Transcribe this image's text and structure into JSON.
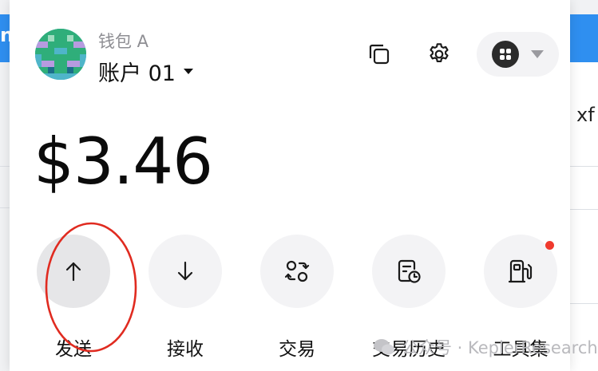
{
  "background": {
    "left_text": "na",
    "right_text": "xf"
  },
  "header": {
    "wallet_name": "钱包 A",
    "account_name": "账户 01",
    "avatar_icon": "pixel-avatar-icon",
    "copy_icon": "copy-icon",
    "settings_icon": "gear-icon",
    "network_icon": "grid-icon"
  },
  "balance": {
    "amount": "$3.46"
  },
  "actions": [
    {
      "label": "发送",
      "icon": "arrow-up-icon"
    },
    {
      "label": "接收",
      "icon": "arrow-down-icon"
    },
    {
      "label": "交易",
      "icon": "swap-icon"
    },
    {
      "label": "交易历史",
      "icon": "history-icon"
    },
    {
      "label": "工具集",
      "icon": "gas-pump-icon",
      "notification": true
    }
  ],
  "watermark": {
    "text": "公众号 · KeplerResearch"
  },
  "colors": {
    "accent_blue": "#2f8ff0",
    "notification_red": "#f03a2e",
    "annotation_red": "#e02b20"
  }
}
